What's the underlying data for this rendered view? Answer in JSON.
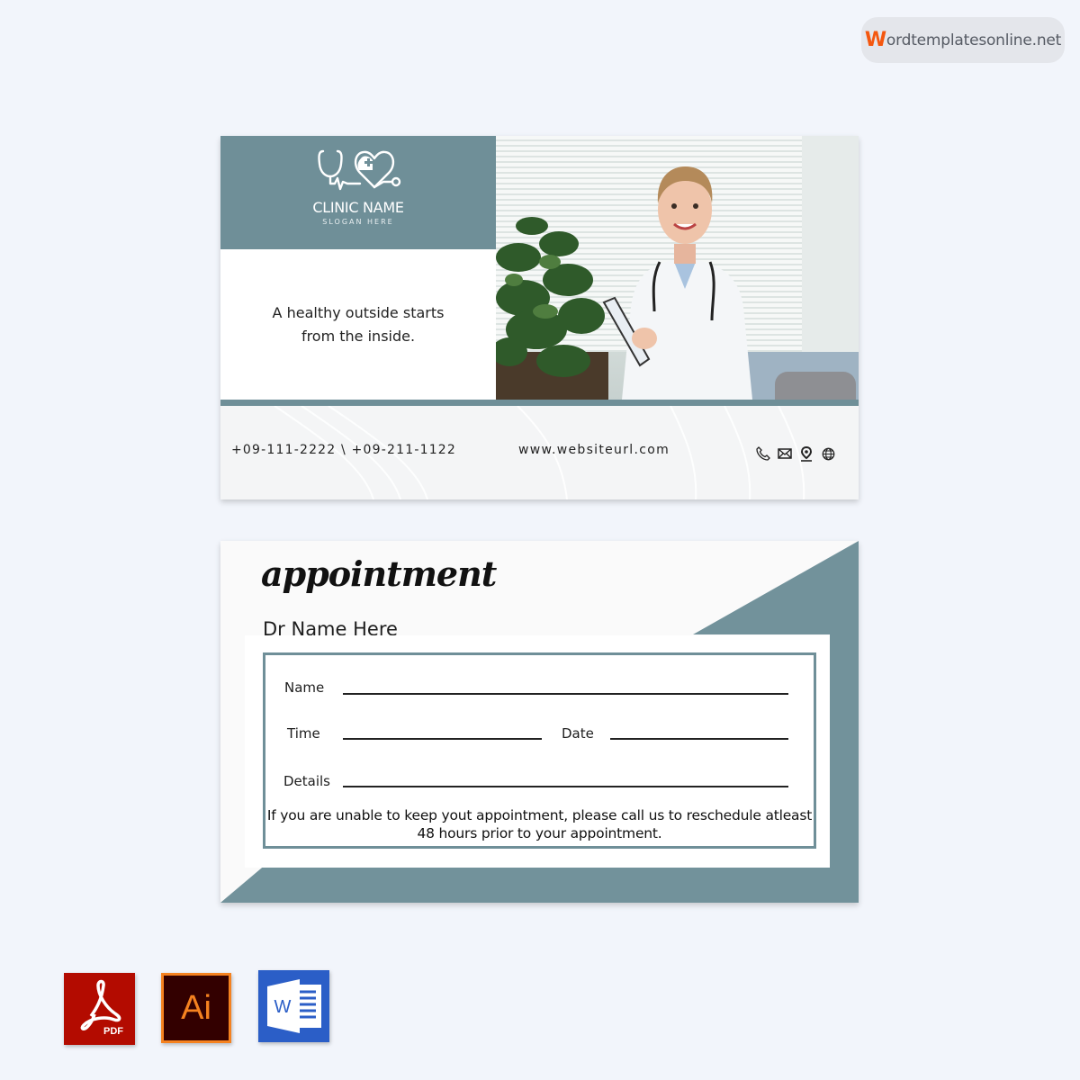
{
  "watermark": {
    "brand_initial": "W",
    "brand_rest": "ordtemplatesonline.net"
  },
  "front_card": {
    "clinic_name": "CLINIC NAME",
    "slogan": "SLOGAN HERE",
    "logo_icon": "stethoscope-heart-icon",
    "tagline": "A healthy outside starts from the inside.",
    "photo_alt": "Smiling doctor in white coat holding a clipboard",
    "phones": "+09-111-2222 \\ +09-211-1122",
    "website": "www.websiteurl.com",
    "contact_icons": [
      "phone-icon",
      "mail-icon",
      "location-pin-icon",
      "globe-icon"
    ]
  },
  "back_card": {
    "title": "appointment",
    "doctor_name": "Dr Name Here",
    "fields": {
      "name": "Name",
      "time": "Time",
      "date": "Date",
      "details": "Details"
    },
    "notice": "If you are unable to keep yout appointment, please call us to reschedule atleast 48 hours prior to your appointment."
  },
  "formats": [
    {
      "name": "PDF",
      "label": "PDF",
      "color": "#b30b00"
    },
    {
      "name": "Illustrator",
      "label": "Ai",
      "color": "#330000"
    },
    {
      "name": "Word",
      "label": "W",
      "color": "#2b5ec7"
    }
  ],
  "colors": {
    "accent": "#6f8f98",
    "background": "#f2f5fb",
    "brand_orange": "#f4570f"
  }
}
